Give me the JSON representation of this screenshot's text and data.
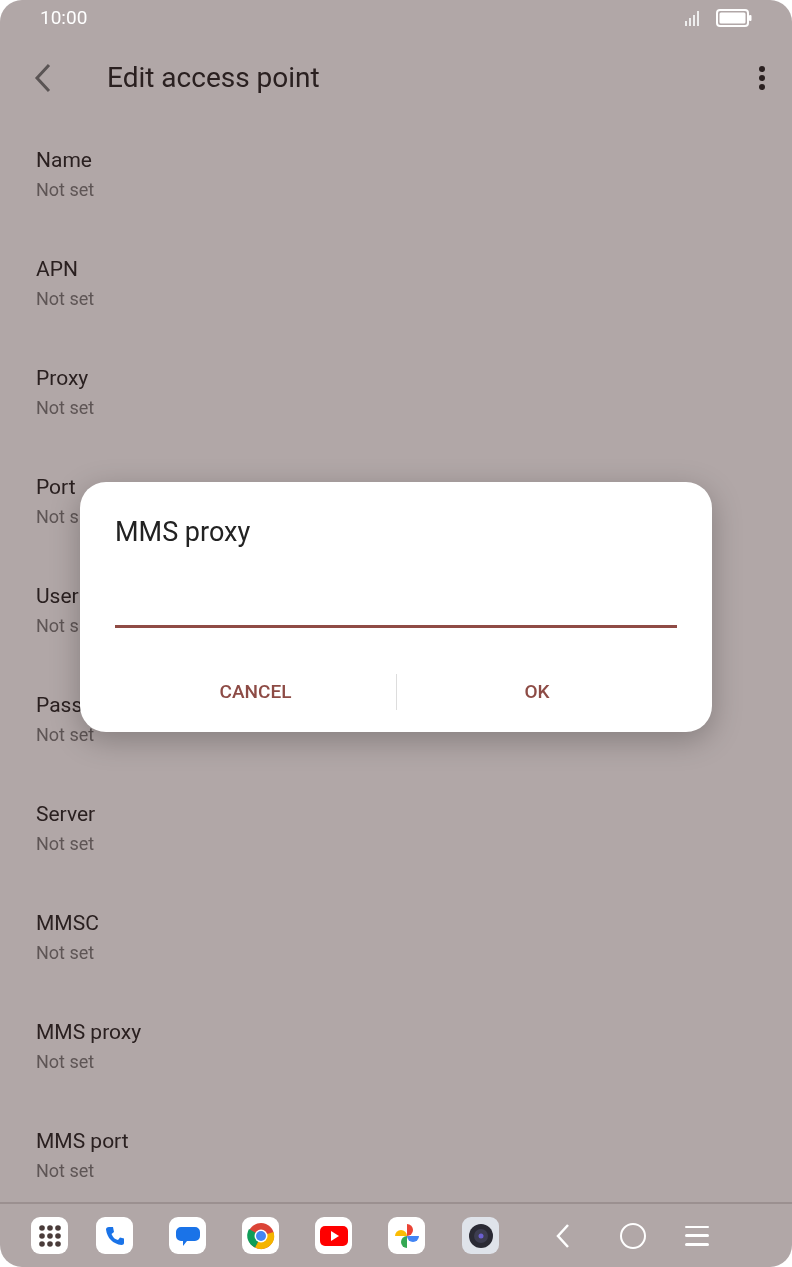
{
  "status_bar": {
    "time": "10:00"
  },
  "app_bar": {
    "title": "Edit access point"
  },
  "settings": [
    {
      "label": "Name",
      "value": "Not set"
    },
    {
      "label": "APN",
      "value": "Not set"
    },
    {
      "label": "Proxy",
      "value": "Not set"
    },
    {
      "label": "Port",
      "value": "Not s"
    },
    {
      "label": "User",
      "value": "Not s"
    },
    {
      "label": "Pass",
      "value": "Not set"
    },
    {
      "label": "Server",
      "value": "Not set"
    },
    {
      "label": "MMSC",
      "value": "Not set"
    },
    {
      "label": "MMS proxy",
      "value": "Not set"
    },
    {
      "label": "MMS port",
      "value": "Not set"
    }
  ],
  "dialog": {
    "title": "MMS proxy",
    "field": {
      "focused": true
    },
    "buttons": [
      {
        "label": "CANCEL"
      },
      {
        "label": "OK"
      }
    ]
  }
}
